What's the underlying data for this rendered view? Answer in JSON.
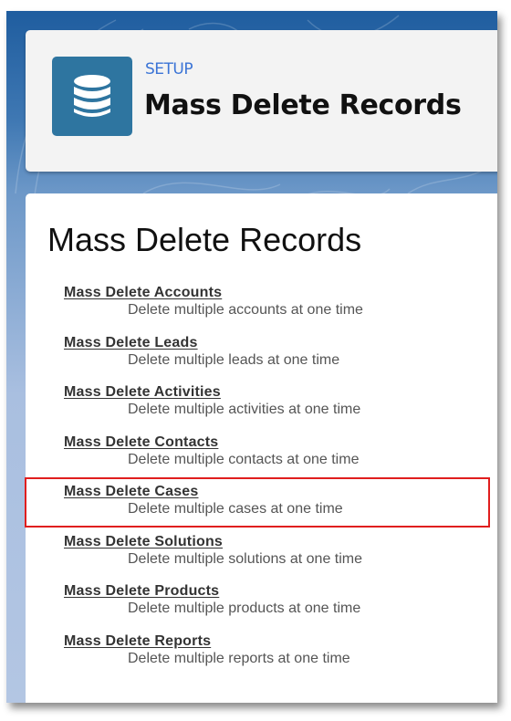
{
  "header": {
    "icon": "database-icon",
    "eyebrow": "SETUP",
    "title": "Mass Delete Records",
    "icon_color": "#2e75a0",
    "eyebrow_color": "#3b74d6"
  },
  "main": {
    "title": "Mass Delete Records",
    "items": [
      {
        "label": "Mass Delete Accounts",
        "description": "Delete multiple accounts at one time"
      },
      {
        "label": "Mass Delete Leads",
        "description": "Delete multiple leads at one time"
      },
      {
        "label": "Mass Delete Activities",
        "description": "Delete multiple activities at one time"
      },
      {
        "label": "Mass Delete Contacts",
        "description": "Delete multiple contacts at one time"
      },
      {
        "label": "Mass Delete Cases",
        "description": "Delete multiple cases at one time"
      },
      {
        "label": "Mass Delete Solutions",
        "description": "Delete multiple solutions at one time"
      },
      {
        "label": "Mass Delete Products",
        "description": "Delete multiple products at one time"
      },
      {
        "label": "Mass Delete Reports",
        "description": "Delete multiple reports at one time"
      }
    ],
    "highlighted_item": "Mass Delete Cases",
    "highlight_color": "#e01e1e"
  }
}
